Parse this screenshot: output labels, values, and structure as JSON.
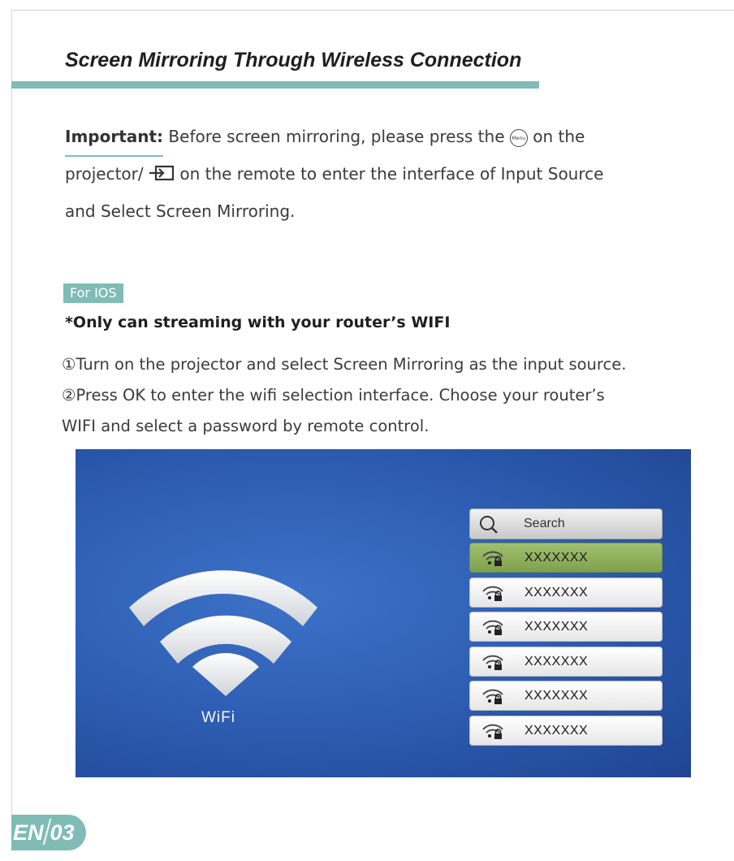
{
  "section": {
    "title": "Screen Mirroring Through Wireless Connection"
  },
  "important": {
    "label": "Important:",
    "line1_before_icon": " Before screen mirroring, please press the ",
    "menu_icon_text": "Menu",
    "line1_after_icon": " on the",
    "line2_before_icon": "projector/ ",
    "line2_after_icon": " on the remote to enter the interface of Input Source",
    "line3": "and Select Screen Mirroring."
  },
  "ios": {
    "tag": "For IOS",
    "note": "*Only can streaming with your router’s WIFI",
    "steps": [
      "①Turn on the projector and select Screen Mirroring as the input source.",
      "②Press OK to enter the wifi selection interface. Choose your router’s",
      "WIFI and select a password by remote control."
    ]
  },
  "screen": {
    "wifi_label": "WiFi",
    "search_label": "Search",
    "networks": [
      "XXXXXXX",
      "XXXXXXX",
      "XXXXXXX",
      "XXXXXXX",
      "XXXXXXX",
      "XXXXXXX"
    ],
    "selected_index": 0
  },
  "page_badge": {
    "lang": "EN",
    "page": "03"
  },
  "icons": [
    "menu-icon",
    "input-source-icon",
    "search-icon",
    "wifi-lock-icon",
    "wifi-icon"
  ],
  "colors": {
    "accent": "#7fbcb6",
    "screen_blue": "#2f5fb4",
    "selected_green": "#8fb15c"
  }
}
